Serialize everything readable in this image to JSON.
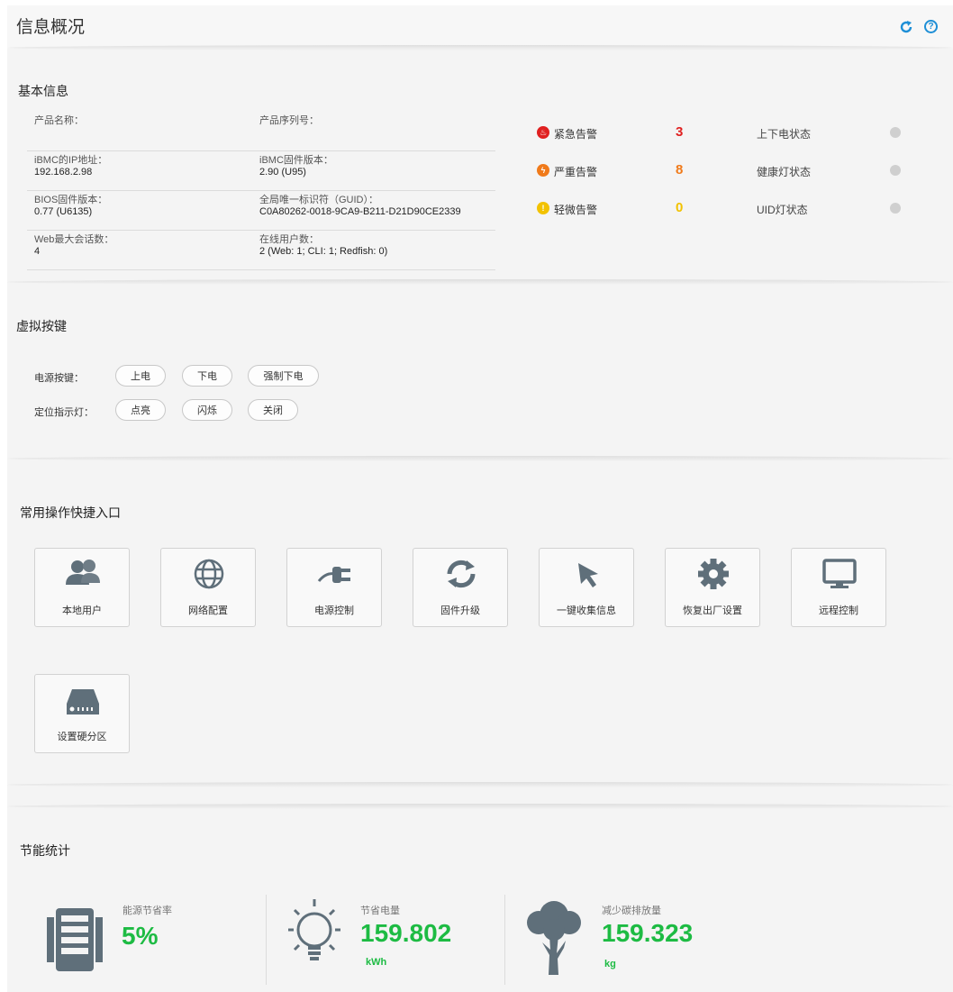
{
  "header": {
    "title": "信息概况",
    "refresh_icon": "refresh-icon",
    "help_icon": "help-icon",
    "help_glyph": "?"
  },
  "basic_info": {
    "section_title": "基本信息",
    "rows": [
      {
        "l1": "产品名称：",
        "v1": "",
        "l2": "产品序列号：",
        "v2": ""
      },
      {
        "l1": "iBMC的IP地址：",
        "v1": "192.168.2.98",
        "l2": "iBMC固件版本：",
        "v2": "2.90 (U95)"
      },
      {
        "l1": "BIOS固件版本：",
        "v1": "0.77 (U6135)",
        "l2": "全局唯一标识符（GUID）：",
        "v2": "C0A80262-0018-9CA9-B211-D21D90CE2339"
      },
      {
        "l1": "Web最大会话数：",
        "v1": "4",
        "l2": "在线用户数：",
        "v2": "2 (Web: 1; CLI: 1; Redfish: 0)"
      }
    ],
    "alarms": [
      {
        "label": "紧急告警",
        "count": "3",
        "color": "#e02020",
        "glyph": "♨"
      },
      {
        "label": "严重告警",
        "count": "8",
        "color": "#f07a1a",
        "glyph": "ϟ"
      },
      {
        "label": "轻微告警",
        "count": "0",
        "color": "#f2c200",
        "glyph": "!"
      }
    ],
    "statuses": [
      {
        "label": "上下电状态"
      },
      {
        "label": "健康灯状态"
      },
      {
        "label": "UID灯状态"
      }
    ]
  },
  "virtual_keys": {
    "section_title": "虚拟按键",
    "power_label": "电源按键：",
    "power_buttons": [
      "上电",
      "下电",
      "强制下电"
    ],
    "locator_label": "定位指示灯：",
    "locator_buttons": [
      "点亮",
      "闪烁",
      "关闭"
    ]
  },
  "shortcuts": {
    "section_title": "常用操作快捷入口",
    "items": [
      {
        "label": "本地用户",
        "icon": "users-icon"
      },
      {
        "label": "网络配置",
        "icon": "globe-icon"
      },
      {
        "label": "电源控制",
        "icon": "plug-icon"
      },
      {
        "label": "固件升级",
        "icon": "sync-icon"
      },
      {
        "label": "一键收集信息",
        "icon": "cursor-icon"
      },
      {
        "label": "恢复出厂设置",
        "icon": "gear-icon"
      },
      {
        "label": "远程控制",
        "icon": "monitor-icon"
      },
      {
        "label": "设置硬分区",
        "icon": "disk-icon"
      }
    ]
  },
  "energy": {
    "section_title": "节能统计",
    "saving_rate_label": "能源节省率",
    "saving_rate_value": "5%",
    "power_saved_label": "节省电量",
    "power_saved_value": "159.802",
    "power_saved_unit": "kWh",
    "carbon_label": "减少碳排放量",
    "carbon_value": "159.323",
    "carbon_unit": "kg",
    "accent_color": "#1dbb43"
  }
}
